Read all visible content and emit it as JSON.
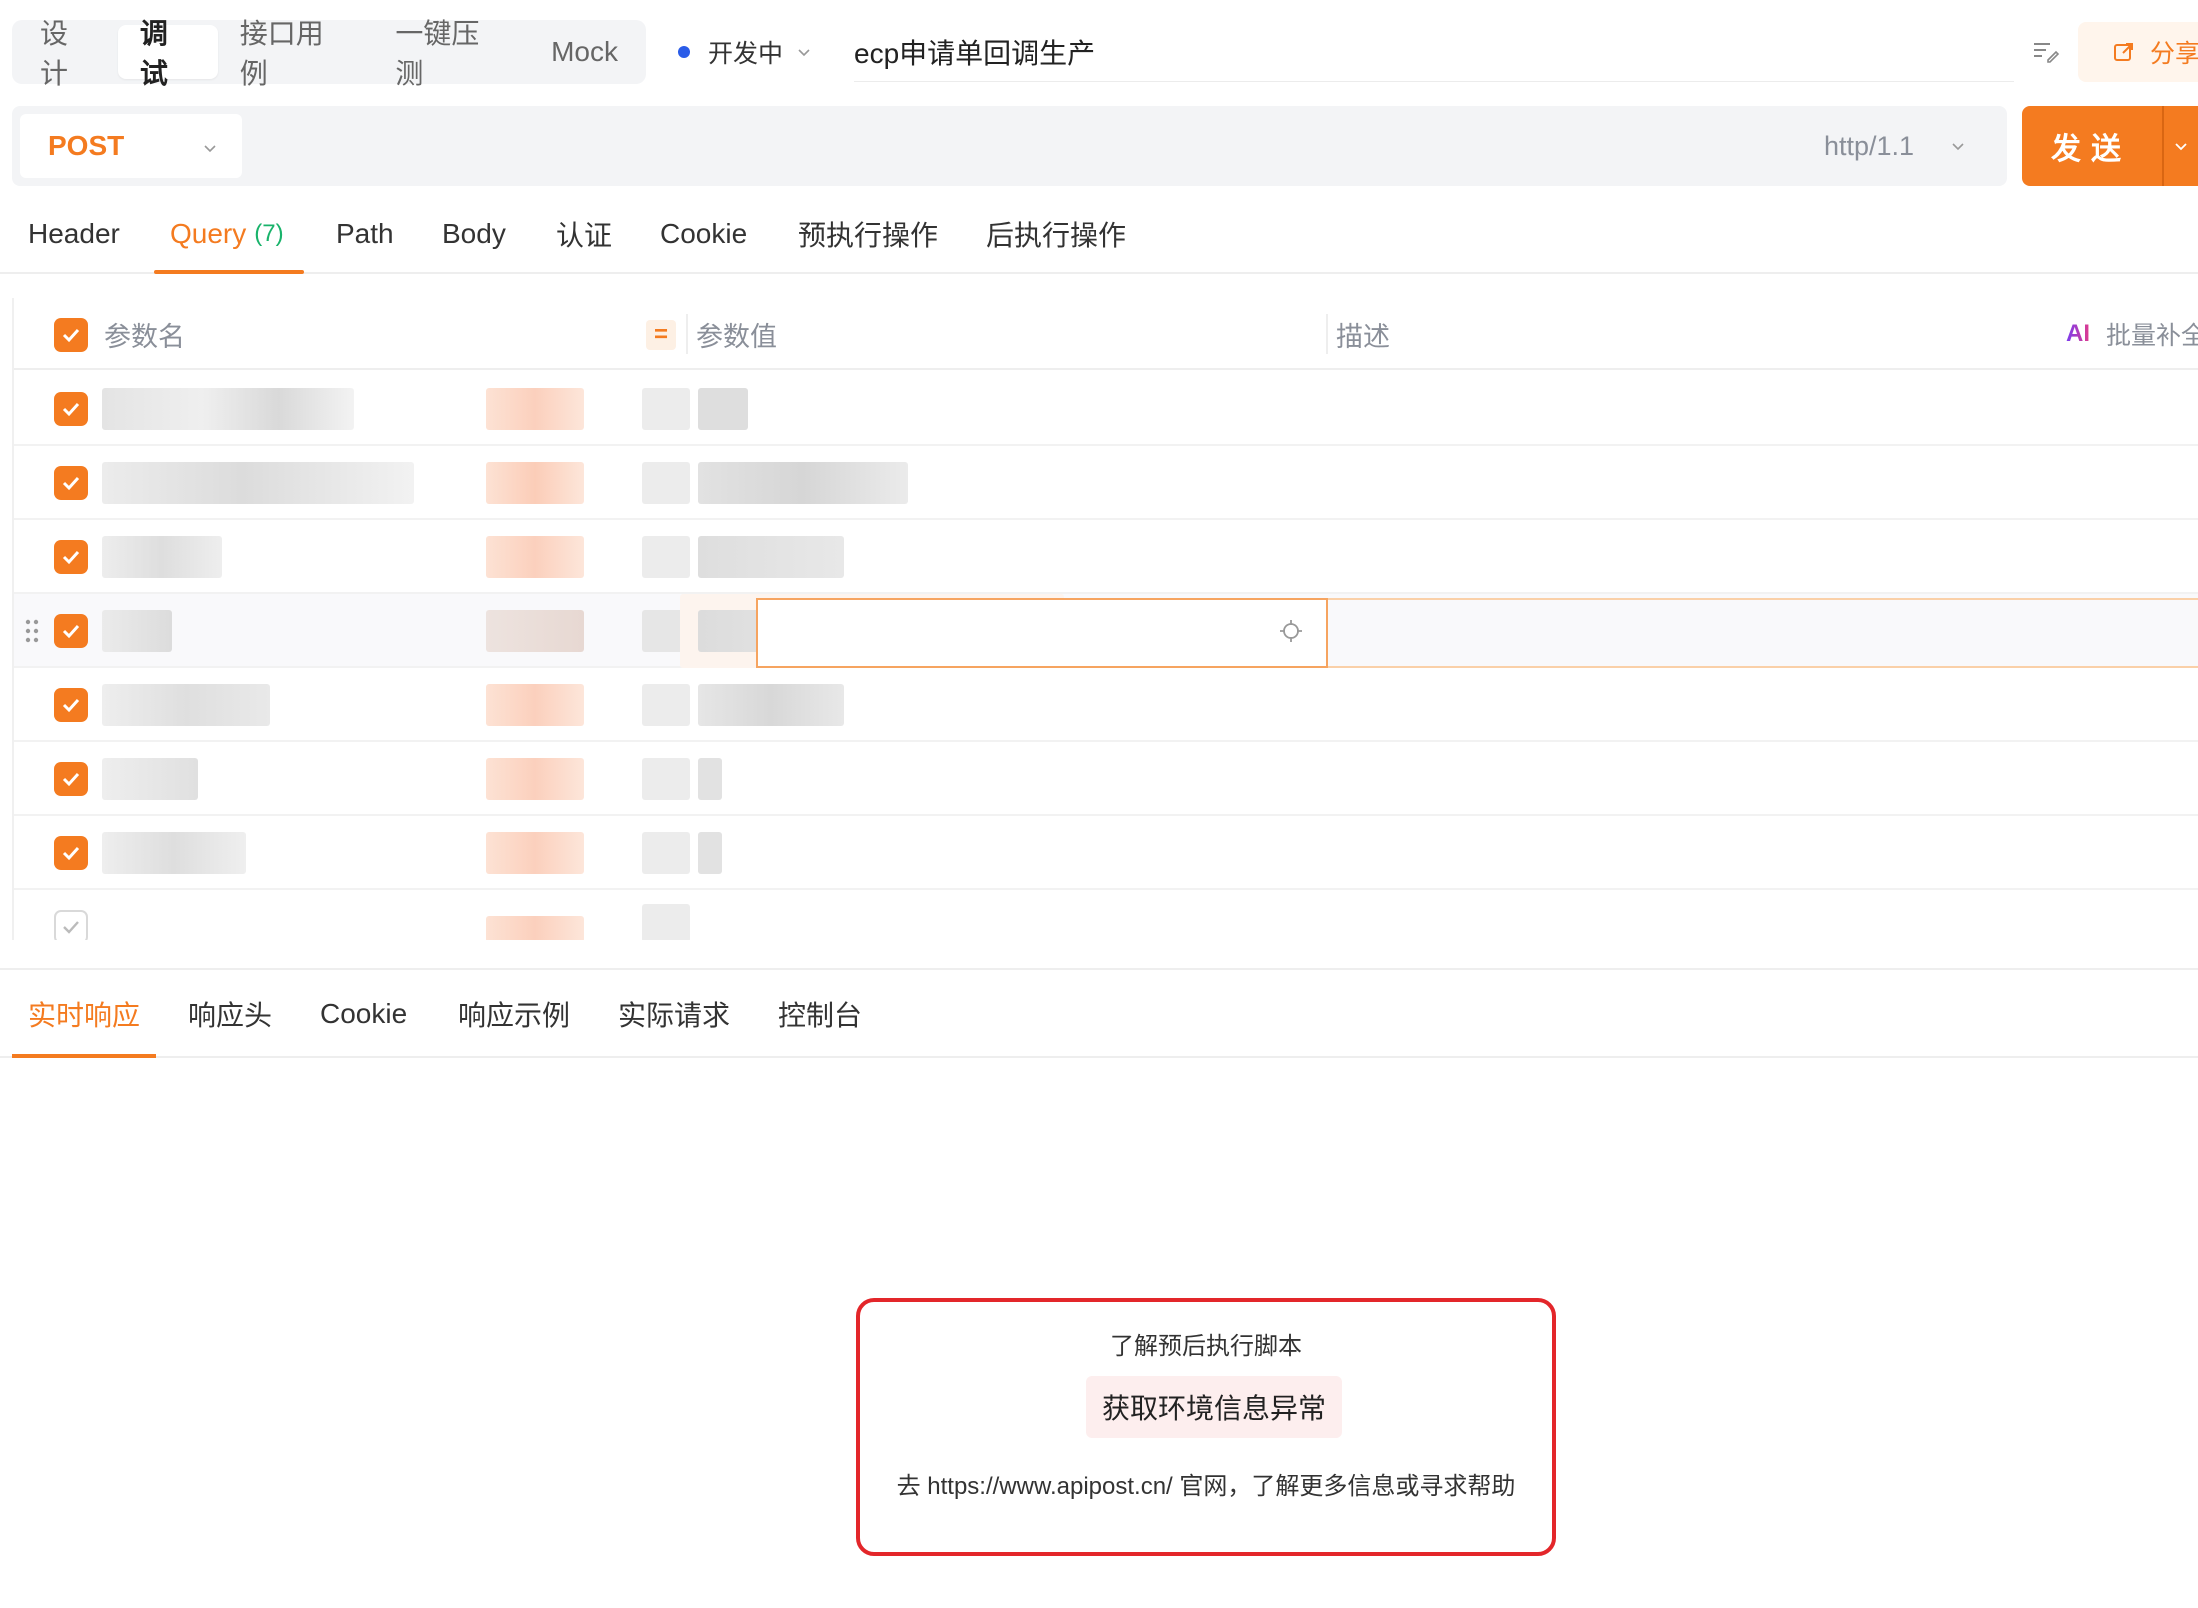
{
  "mode_tabs": [
    {
      "label": "设计",
      "active": false
    },
    {
      "label": "调试",
      "active": true
    },
    {
      "label": "接口用例",
      "active": false
    },
    {
      "label": "一键压测",
      "active": false
    },
    {
      "label": "Mock",
      "active": false
    }
  ],
  "status": {
    "label": "开发中",
    "dot_color": "#2a5ce8"
  },
  "api_title": "ecp申请单回调生产",
  "share_label": "分享",
  "request": {
    "method": "POST",
    "url": "",
    "protocol": "http/1.1",
    "send_label": "发送"
  },
  "request_tabs": [
    {
      "label": "Header",
      "count": null,
      "active": false
    },
    {
      "label": "Query",
      "count": "(7)",
      "active": true
    },
    {
      "label": "Path",
      "count": null,
      "active": false
    },
    {
      "label": "Body",
      "count": null,
      "active": false
    },
    {
      "label": "认证",
      "count": null,
      "active": false
    },
    {
      "label": "Cookie",
      "count": null,
      "active": false
    },
    {
      "label": "预执行操作",
      "count": null,
      "active": false
    },
    {
      "label": "后执行操作",
      "count": null,
      "active": false
    }
  ],
  "params_table": {
    "columns": {
      "name": "参数名",
      "value": "参数值",
      "description": "描述"
    },
    "eq_symbol": "=",
    "ai_label": "AI",
    "bulk_label": "批量补全",
    "rows": [
      {
        "checked": true,
        "name": "",
        "type": "",
        "value": "",
        "description": ""
      },
      {
        "checked": true,
        "name": "",
        "type": "",
        "value": "",
        "description": ""
      },
      {
        "checked": true,
        "name": "",
        "type": "",
        "value": "",
        "description": ""
      },
      {
        "checked": true,
        "name": "",
        "type": "",
        "value": "",
        "description": ""
      },
      {
        "checked": true,
        "name": "",
        "type": "",
        "value": "",
        "description": ""
      },
      {
        "checked": true,
        "name": "",
        "type": "",
        "value": "",
        "description": ""
      },
      {
        "checked": true,
        "name": "",
        "type": "",
        "value": "",
        "description": ""
      },
      {
        "checked": false,
        "name": "",
        "type": "",
        "value": "",
        "description": ""
      }
    ]
  },
  "response_tabs": [
    {
      "label": "实时响应",
      "active": true
    },
    {
      "label": "响应头",
      "active": false
    },
    {
      "label": "Cookie",
      "active": false
    },
    {
      "label": "响应示例",
      "active": false
    },
    {
      "label": "实际请求",
      "active": false
    },
    {
      "label": "控制台",
      "active": false
    }
  ],
  "error_panel": {
    "link": "了解预后执行脚本",
    "message": "获取环境信息异常",
    "help": "去 https://www.apipost.cn/ 官网，了解更多信息或寻求帮助"
  },
  "colors": {
    "accent": "#f47b20",
    "error_border": "#e3262a",
    "count_green": "#19b36b"
  }
}
